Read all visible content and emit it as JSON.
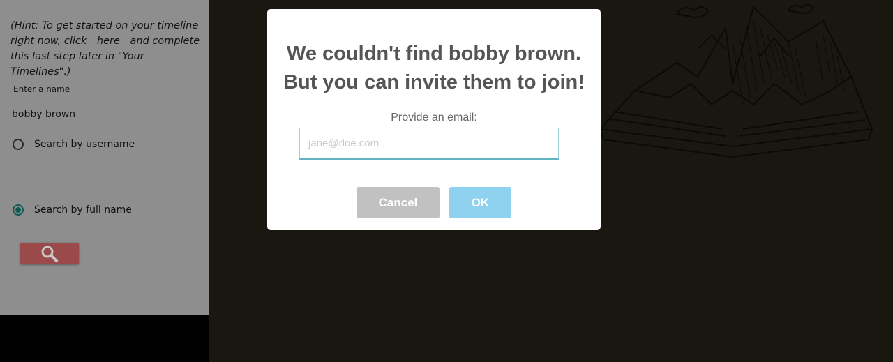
{
  "sidebar": {
    "hint_before": "(Hint: To get started on your timeline right now, click",
    "hint_link": "here",
    "hint_after": "and complete this last step later in \"Your Timelines\".)",
    "name_label": "Enter a name",
    "name_value": "bobby brown",
    "radio_username": "Search by username",
    "radio_fullname": "Search by full name",
    "selected_option": "Search by full name"
  },
  "modal": {
    "title_line1": "We couldn't find bobby brown.",
    "title_line2": "But you can invite them to join!",
    "email_label": "Provide an email:",
    "email_placeholder": "jane@doe.com",
    "email_value": "",
    "cancel_label": "Cancel",
    "ok_label": "OK"
  },
  "colors": {
    "overlay_background": "#1a1710",
    "sidebar_dimmed": "#8e8e8e",
    "search_button": "#9a4a4a",
    "cancel_button": "#c1c1c1",
    "ok_button": "#8fd2f0",
    "radio_checked": "#0f5a52"
  },
  "icons": {
    "search_button": "search-icon",
    "background_art": "open-book-illustration"
  }
}
